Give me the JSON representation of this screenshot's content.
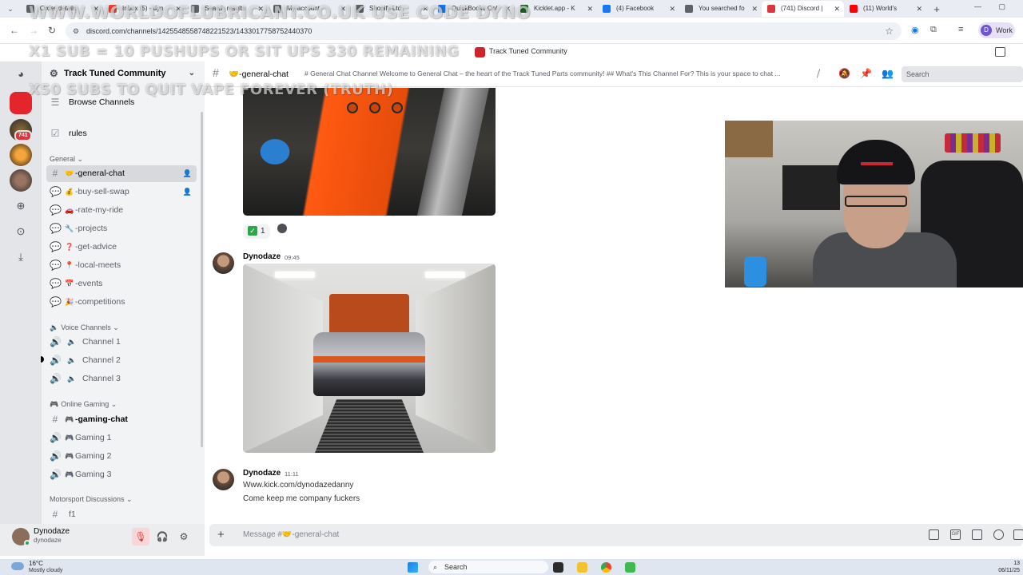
{
  "browser": {
    "tabs": [
      {
        "label": "Order details",
        "color": "#5f6368"
      },
      {
        "label": "Inbox (5) - dyn",
        "color": "#ea4335"
      },
      {
        "label": "Search results",
        "color": "#5f6368"
      },
      {
        "label": "My account",
        "color": "#5f6368"
      },
      {
        "label": "Shopify Ltd",
        "color": "#5f6368"
      },
      {
        "label": "QuickBooks Onl",
        "color": "#1a73e8"
      },
      {
        "label": "Kicklet.app - K",
        "color": "#1b5e20"
      },
      {
        "label": "(4) Facebook",
        "color": "#1877f2"
      },
      {
        "label": "You searched fo",
        "color": "#5f6368"
      },
      {
        "label": "(741) Discord |",
        "color": "#da373c"
      },
      {
        "label": "(11) World's",
        "color": "#ff0000"
      }
    ],
    "url": "discord.com/channels/1425548558748221523/1433017758752440370",
    "profile_label": "Work",
    "profile_initial": "D"
  },
  "overlay": {
    "line1": "WWW.WORLDOFLUBRICANT.CO.UK USE CODE DYNO",
    "line2": "X1 SUB = 10 PUSHUPS OR SIT UPS 330 REMAINING",
    "line3": "X50 SUBS TO QUIT VAPE FOREVER (TRUTH)"
  },
  "server": {
    "title_top": "Track Tuned Community",
    "name": "Track Tuned Community",
    "browse": "Browse Channels",
    "rules": "rules",
    "categories": {
      "general": "General",
      "voice": "Voice Channels",
      "gaming": "Online Gaming",
      "motorsport": "Motorsport Discussions"
    },
    "general_channels": [
      {
        "emoji": "🤝",
        "name": "-general-chat"
      },
      {
        "emoji": "💰",
        "name": "-buy-sell-swap"
      },
      {
        "emoji": "🚗",
        "name": "-rate-my-ride"
      },
      {
        "emoji": "🔧",
        "name": "-projects"
      },
      {
        "emoji": "❓",
        "name": "-get-advice"
      },
      {
        "emoji": "📍",
        "name": "-local-meets"
      },
      {
        "emoji": "📅",
        "name": "-events"
      },
      {
        "emoji": "🎉",
        "name": "-competitions"
      }
    ],
    "voice_channels": [
      "Channel 1",
      "Channel 2",
      "Channel 3"
    ],
    "gaming_channels": [
      "-gaming-chat",
      "Gaming 1",
      "Gaming 2",
      "Gaming 3"
    ],
    "motorsport_channels": [
      "f1"
    ],
    "rail_badge": "741"
  },
  "user": {
    "name": "Dynodaze",
    "tag": "dynodaze"
  },
  "chat": {
    "channel_emoji": "🤝",
    "channel_name": "-general-chat",
    "topic": "# General Chat Channel Welcome to General Chat – the heart of the Track Tuned Parts community! ## What's This Channel For? This is your space to chat ...",
    "search_placeholder": "Search",
    "reaction_count": "1",
    "messages": [
      {
        "author": "Dynodaze",
        "time": "09:45"
      },
      {
        "author": "Dynodaze",
        "time": "11:11",
        "lines": [
          "Www.kick.com/dynodazedanny",
          "Come keep me company fuckers"
        ]
      }
    ],
    "composer_placeholder": "Message #🤝-general-chat"
  },
  "taskbar": {
    "temp": "16°C",
    "weather": "Mostly cloudy",
    "search": "Search",
    "clock_time": "13",
    "clock_date": "06/11/25"
  },
  "colors": {
    "accent_red": "#da373c",
    "online_green": "#23a55a",
    "selected_bg": "#d7d9dd"
  }
}
